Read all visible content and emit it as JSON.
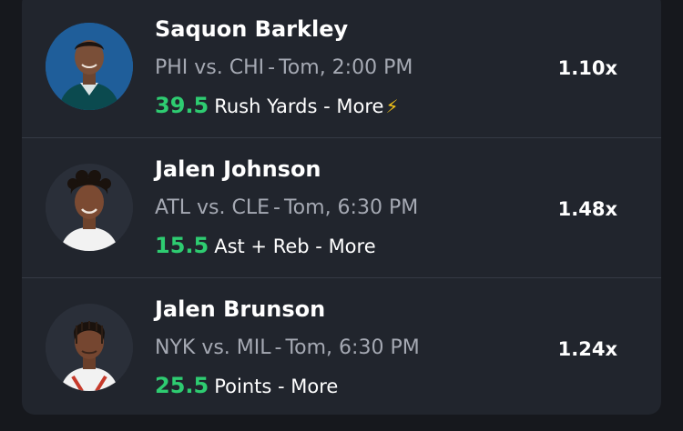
{
  "picks": [
    {
      "player": "Saquon Barkley",
      "matchup": "PHI vs. CHI",
      "time": "Tom, 2:00 PM",
      "line_value": "39.5",
      "stat": "Rush Yards",
      "direction": "More",
      "boost_icon": "lightning-bolt",
      "multiplier": "1.10x",
      "avatar_color": "#1f5e9a",
      "jersey_color": "#0b4a4f"
    },
    {
      "player": "Jalen Johnson",
      "matchup": "ATL vs. CLE",
      "time": "Tom, 6:30 PM",
      "line_value": "15.5",
      "stat": "Ast + Reb",
      "direction": "More",
      "multiplier": "1.48x",
      "jersey_color": "#f2f2f2"
    },
    {
      "player": "Jalen Brunson",
      "matchup": "NYK vs. MIL",
      "time": "Tom, 6:30 PM",
      "line_value": "25.5",
      "stat": "Points",
      "direction": "More",
      "multiplier": "1.24x",
      "jersey_color": "#f2f2f2"
    }
  ],
  "colors": {
    "accent_green": "#2ecc71",
    "card_bg": "#21252d",
    "muted_text": "#a5a9b3"
  },
  "separator": "-"
}
